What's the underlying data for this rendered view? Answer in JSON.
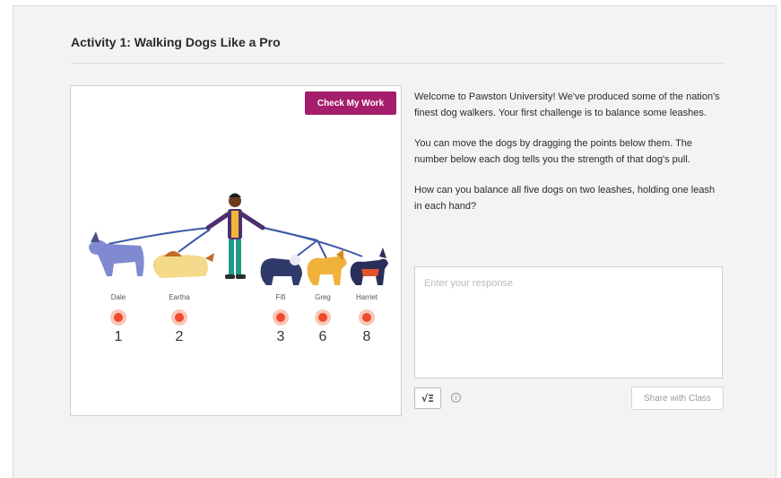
{
  "activity": {
    "title": "Activity 1: Walking Dogs Like a Pro"
  },
  "sketch": {
    "check_button": "Check My Work",
    "dogs": [
      {
        "name": "Dale",
        "strength": "1"
      },
      {
        "name": "Eartha",
        "strength": "2"
      },
      {
        "name": "Fifi",
        "strength": "3"
      },
      {
        "name": "Greg",
        "strength": "6"
      },
      {
        "name": "Harriet",
        "strength": "8"
      }
    ],
    "colors": {
      "check_button": "#a41e6b",
      "point": "#ef4a2c",
      "point_halo": "#f9c8b8"
    }
  },
  "prompt": {
    "paragraph1": "Welcome to Pawston University! We've produced some of the nation's finest dog walkers. Your first challenge is to balance some leashes.",
    "paragraph2": "You can move the dogs by dragging the points below them. The number below each dog tells you the strength of that dog's pull.",
    "paragraph3": "How can you balance all five dogs on two leashes, holding one leash in each hand?"
  },
  "response": {
    "placeholder": "Enter your response",
    "value": ""
  },
  "toolbar": {
    "math_label": "√Ξ",
    "info_glyph": "i",
    "share_button": "Share with Class"
  }
}
